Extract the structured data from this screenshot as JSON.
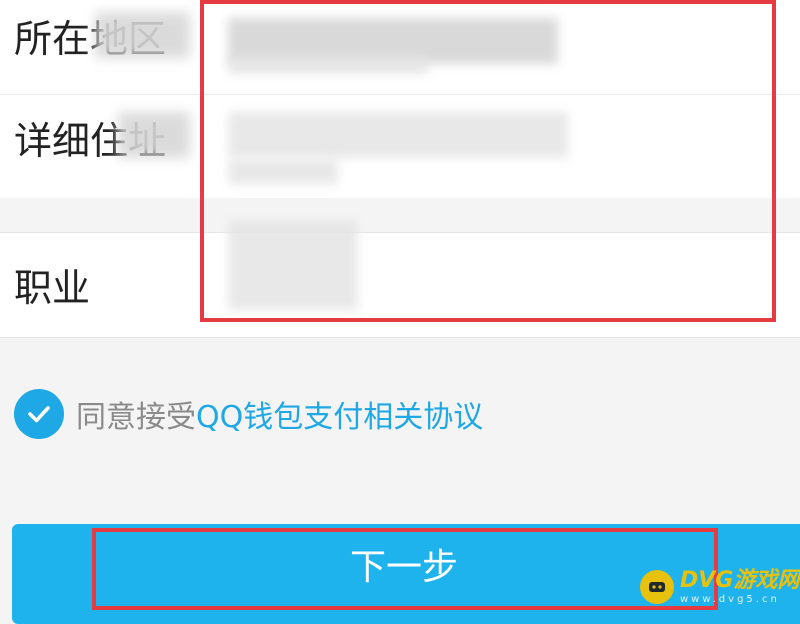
{
  "form": {
    "location_label": "所在地区",
    "address_label": "详细住址",
    "occupation_label": "职业"
  },
  "agreement": {
    "prefix": "同意接受",
    "link": "QQ钱包支付相关协议"
  },
  "next_button_label": "下一步",
  "watermark": {
    "title": "DVG游戏网",
    "subtitle": "www.dvg5.cn"
  },
  "colors": {
    "accent": "#1fa8e6",
    "button": "#1fb3ee",
    "highlight": "#e53b43",
    "watermark": "#f2c200"
  },
  "icons": {
    "agree_check": "check-circle-icon",
    "watermark_logo": "gamepad-icon"
  }
}
